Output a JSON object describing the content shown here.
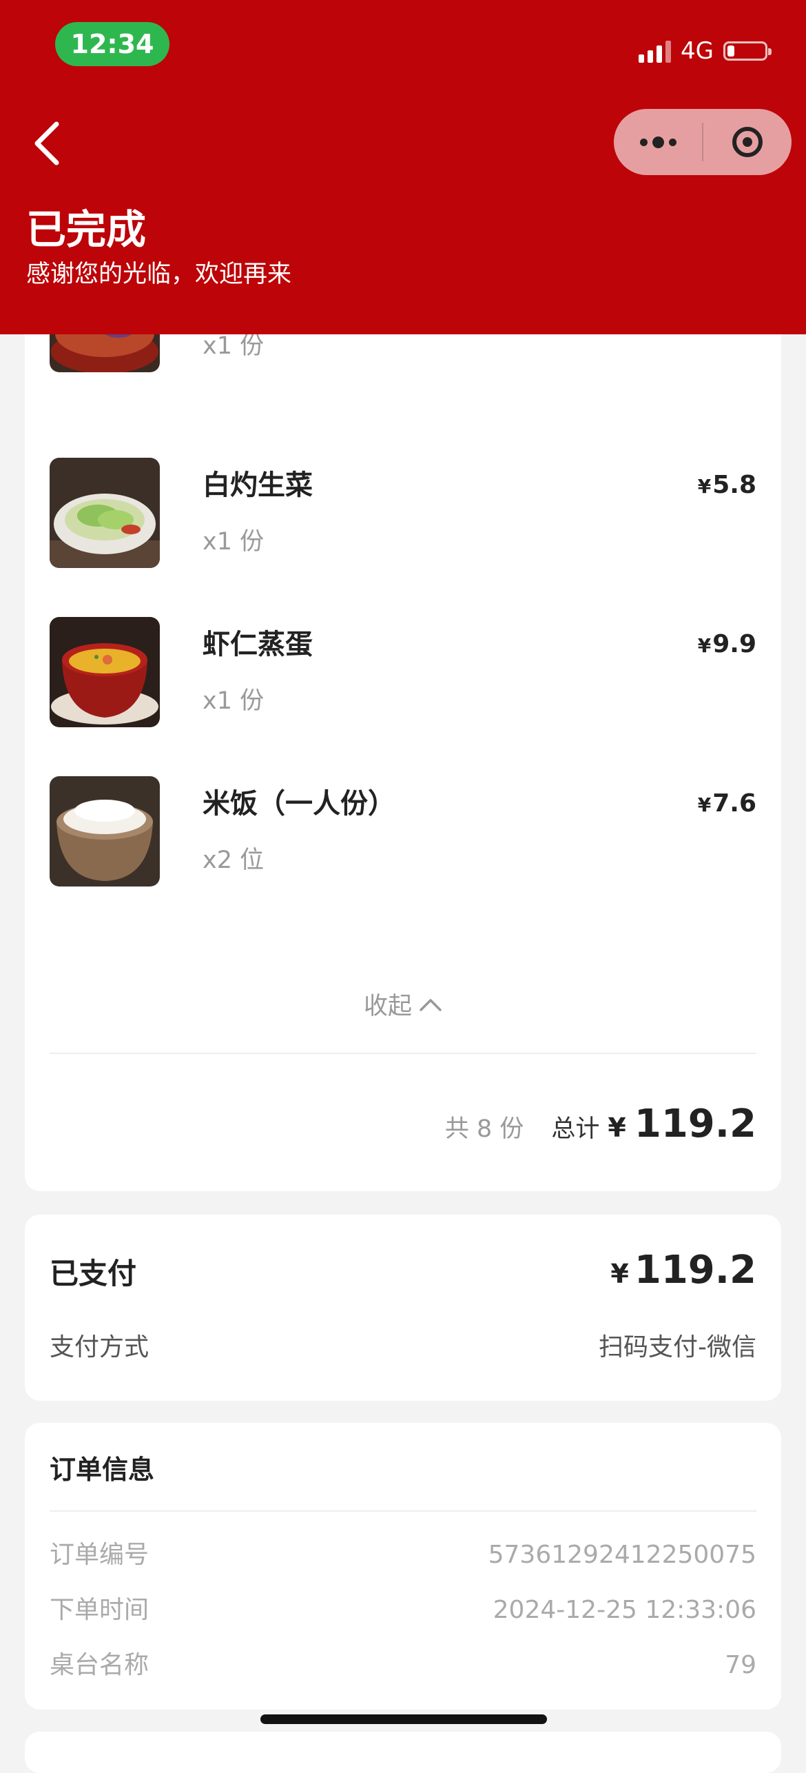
{
  "status_bar": {
    "time": "12:34",
    "network": "4G",
    "battery_level": 0.2
  },
  "header": {
    "title": "已完成",
    "subtitle": "感谢您的光临，欢迎再来",
    "back_icon": "chevron-left-icon",
    "menu_icon": "more-dots-icon",
    "close_icon": "target-circle-icon"
  },
  "items": [
    {
      "name": "",
      "qty": "x1 份",
      "price_symbol": "",
      "price": ""
    },
    {
      "name": "白灼生菜",
      "qty": "x1 份",
      "price_symbol": "¥",
      "price": "5.8"
    },
    {
      "name": "虾仁蒸蛋",
      "qty": "x1 份",
      "price_symbol": "¥",
      "price": "9.9"
    },
    {
      "name": "米饭（一人份）",
      "qty": "x2 位",
      "price_symbol": "¥",
      "price": "7.6"
    }
  ],
  "collapse_label": "收起",
  "summary": {
    "count": "共 8 份",
    "total_label": "总计",
    "currency": "¥",
    "total": "119.2"
  },
  "payment": {
    "paid_label": "已支付",
    "currency": "¥",
    "amount": "119.2",
    "method_label": "支付方式",
    "method_value": "扫码支付-微信"
  },
  "order_info": {
    "title": "订单信息",
    "rows": [
      {
        "label": "订单编号",
        "value": "57361292412250075"
      },
      {
        "label": "下单时间",
        "value": "2024-12-25 12:33:06"
      },
      {
        "label": "桌台名称",
        "value": "79"
      }
    ]
  },
  "colors": {
    "header_red": "#bd0408",
    "status_green": "#2fb74f",
    "page_bg": "#f3f3f3"
  }
}
